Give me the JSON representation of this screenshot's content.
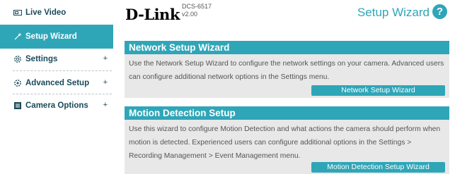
{
  "sidebar": {
    "items": [
      {
        "label": "Live Video",
        "icon": "video-icon",
        "expandable": false,
        "active": false
      },
      {
        "label": "Setup Wizard",
        "icon": "wizard-icon",
        "expandable": false,
        "active": true
      },
      {
        "label": "Settings",
        "icon": "gear-icon",
        "expandable": true,
        "active": false
      },
      {
        "label": "Advanced Setup",
        "icon": "advanced-gear-icon",
        "expandable": true,
        "active": false
      },
      {
        "label": "Camera Options",
        "icon": "list-icon",
        "expandable": true,
        "active": false
      }
    ],
    "expand_symbol": "+"
  },
  "header": {
    "logo": "D-Link",
    "model": "DCS-6517",
    "version": "v2.00",
    "title": "Setup Wizard",
    "help_symbol": "?"
  },
  "sections": [
    {
      "title": "Network Setup Wizard",
      "description": "Use the Network Setup Wizard to configure the network settings on your camera. Advanced users can configure additional network options in the Settings menu.",
      "button_label": "Network Setup Wizard"
    },
    {
      "title": "Motion Detection Setup",
      "description": "Use this wizard to configure Motion Detection and what actions the camera should perform when motion is detected. Experienced users can configure additional options in the Settings > Recording Management > Event Management menu.",
      "button_label": "Motion Detection Setup Wizard"
    }
  ],
  "colors": {
    "accent": "#2fa6b8",
    "body_bg": "#e8e8e8",
    "nav_text": "#1a4a5a"
  }
}
